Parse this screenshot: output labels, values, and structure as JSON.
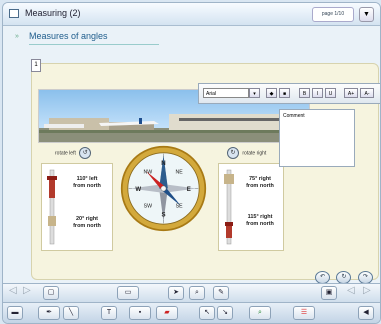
{
  "window": {
    "title": "Measuring (2)",
    "page_info": "page 1/10",
    "page_btn": "▼"
  },
  "content": {
    "subtitle": "Measures of angles",
    "page_number": "1"
  },
  "rotate": {
    "left_label": "rotate left",
    "right_label": "rotate right"
  },
  "left_card": {
    "top_text": [
      "110° left",
      "from north"
    ],
    "bottom_text": [
      "20° right",
      "from north"
    ]
  },
  "right_card": {
    "top_text": [
      "75° right",
      "from north"
    ],
    "bottom_text": [
      "115° right",
      "from north"
    ]
  },
  "compass": {
    "letters": [
      "N",
      "NE",
      "E",
      "SE",
      "S",
      "SW",
      "W",
      "NW"
    ]
  },
  "text_toolbar": {
    "font_value": "Arial",
    "buttons": [
      "B",
      "I",
      "U",
      "A+",
      "A-"
    ]
  },
  "comment": {
    "label": "Comment"
  },
  "nav": {
    "prev": "◁",
    "next": "▷",
    "prev2": "◁",
    "next2": "▷"
  },
  "colors": {
    "accent": "#1f5d8c",
    "background": "#f6f4df"
  }
}
